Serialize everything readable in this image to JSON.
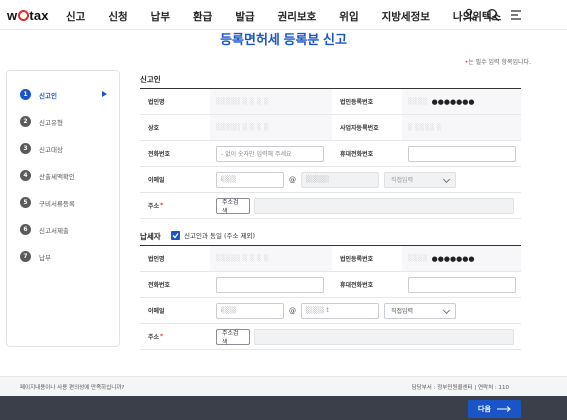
{
  "logo": {
    "pre": "w",
    "post": "tax"
  },
  "nav": [
    "신고",
    "신청",
    "납부",
    "환급",
    "발급",
    "권리보호",
    "위입",
    "지방세정보",
    "나의위택스"
  ],
  "page_title": "등록면허세 등록분 신고",
  "req_note": {
    "dot": "•",
    "text": "는 필수 입력 항목입니다."
  },
  "steps": [
    {
      "num": "1",
      "label": "신고인"
    },
    {
      "num": "2",
      "label": "신고유형"
    },
    {
      "num": "3",
      "label": "신고대상"
    },
    {
      "num": "4",
      "label": "산출세액확인"
    },
    {
      "num": "5",
      "label": "구비서류등록"
    },
    {
      "num": "6",
      "label": "신고서제출"
    },
    {
      "num": "7",
      "label": "납부"
    }
  ],
  "reporter": {
    "title": "신고인",
    "corp_name_label": "법인명",
    "corp_name_value": "░░░░░  ░ ░ ░ ░",
    "corp_reg_label": "법인등록번호",
    "corp_reg_value": "░░░░",
    "corp_reg_dots": "●●●●●●●",
    "trade_label": "상호",
    "trade_value": "░░░░░  ░ ░ ░ ░",
    "biz_reg_label": "사업자등록번호",
    "biz_reg_value": "░ ░░░░  ░",
    "phone_label": "전화번호",
    "phone_placeholder": "- 없이 숫자만 입력해 주세요",
    "mobile_label": "휴대전화번호",
    "email_label": "이메일",
    "email_local": "i░░░",
    "email_at": "@",
    "email_domain": "░░░░░",
    "email_select": "직접입력",
    "address_label": "주소",
    "address_req": "*",
    "address_button": "주소검색"
  },
  "taxpayer": {
    "title": "납세자",
    "same_label": "신고인과 동일 (주소 제외)",
    "corp_name_label": "법인명",
    "corp_name_value": "░░░░░  ░ ░ ░ ░",
    "corp_reg_label": "법인등록번호",
    "corp_reg_value": "░░░░",
    "corp_reg_dots": "●●●●●●●",
    "phone_label": "전화번호",
    "mobile_label": "휴대전화번호",
    "email_label": "이메일",
    "email_local": "i░░░",
    "email_at": "@",
    "email_domain": "░░░░ t",
    "email_select": "직접입력",
    "address_label": "주소",
    "address_req": "*",
    "address_button": "주소검색"
  },
  "footer": {
    "question": "페이지내용이나 사용 편의성에 만족하십니까?",
    "info": "담당부서 : 정부민원콜센터  |  연락처 : 110"
  },
  "next_button": "다음",
  "colors": {
    "accent": "#1a55c8",
    "logo_o": "#e52b2b",
    "bottom_bar": "#3a3f4a"
  }
}
